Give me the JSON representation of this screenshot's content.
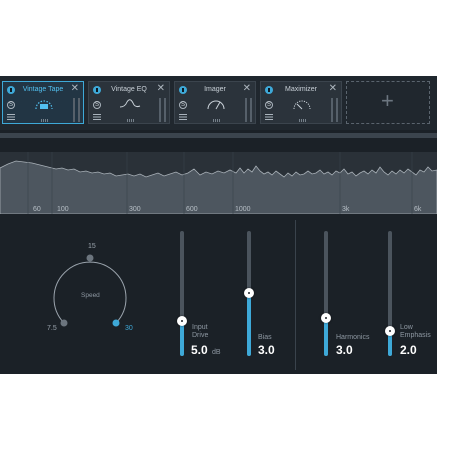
{
  "modules": [
    {
      "title": "Vintage Tape",
      "active": true,
      "icon": "tape-reel-icon"
    },
    {
      "title": "Vintage EQ",
      "active": false,
      "icon": "eq-curve-icon"
    },
    {
      "title": "Imager",
      "active": false,
      "icon": "imager-meter-icon"
    },
    {
      "title": "Maximizer",
      "active": false,
      "icon": "maximizer-gauge-icon"
    }
  ],
  "add_slot": {
    "symbol": "+"
  },
  "module_close_symbol": "✕",
  "module_solo_symbol": "S",
  "spectrum": {
    "frequency_labels": [
      "60",
      "100",
      "300",
      "600",
      "1000",
      "3k",
      "6k"
    ]
  },
  "speed_knob": {
    "label": "Speed",
    "min_label": "7.5",
    "mid_label": "15",
    "max_label": "30",
    "selected": "30"
  },
  "sliders": {
    "input_drive": {
      "label_line1": "Input",
      "label_line2": "Drive",
      "value": "5.0",
      "unit": "dB",
      "level": 0.28
    },
    "bias": {
      "label_line1": "Bias",
      "value": "3.0",
      "level": 0.5
    },
    "harmonics": {
      "label_line1": "Harmonics",
      "value": "3.0",
      "level": 0.3
    },
    "low_emphasis": {
      "label_line1": "Low",
      "label_line2": "Emphasis",
      "value": "2.0",
      "level": 0.2
    }
  },
  "colors": {
    "accent": "#3ea9d8",
    "panel": "#1b2127",
    "module_bg": "#2b333b"
  }
}
